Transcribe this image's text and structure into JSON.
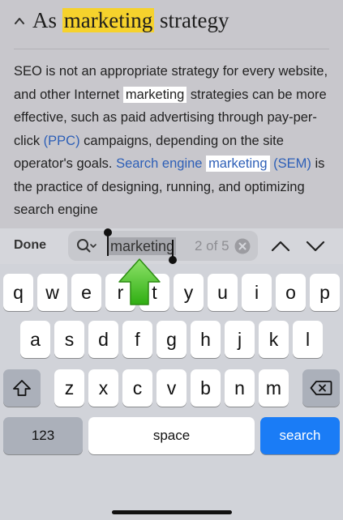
{
  "article": {
    "heading_prefix": "As",
    "heading_highlight": "marketing",
    "heading_suffix": "strategy",
    "paragraph": {
      "t1": "SEO is not an appropriate strategy for every website, and other Internet ",
      "m1": "marketing",
      "t2": " strategies can be more effective, such as paid advertising through pay-per-click ",
      "link1": "(PPC)",
      "t3": " campaigns, depending on the site operator's goals. ",
      "link2a": "Search engine ",
      "m2": "marketing",
      "link2b": " (SEM)",
      "t4": " is the practice of designing, running, and optimizing search engine"
    }
  },
  "findbar": {
    "done_label": "Done",
    "query": "marketing",
    "match_count": "2 of 5",
    "icons": [
      "search-icon",
      "clear-icon",
      "chevron-up-icon",
      "chevron-down-icon"
    ]
  },
  "keyboard": {
    "row1": [
      "q",
      "w",
      "e",
      "r",
      "t",
      "y",
      "u",
      "i",
      "o",
      "p"
    ],
    "row2": [
      "a",
      "s",
      "d",
      "f",
      "g",
      "h",
      "j",
      "k",
      "l"
    ],
    "row3": [
      "z",
      "x",
      "c",
      "v",
      "b",
      "n",
      "m"
    ],
    "numbers_label": "123",
    "space_label": "space",
    "search_label": "search",
    "accent_color": "#1a7cf6"
  },
  "annotation": {
    "icon": "green-up-arrow",
    "color": "#47c21a"
  }
}
